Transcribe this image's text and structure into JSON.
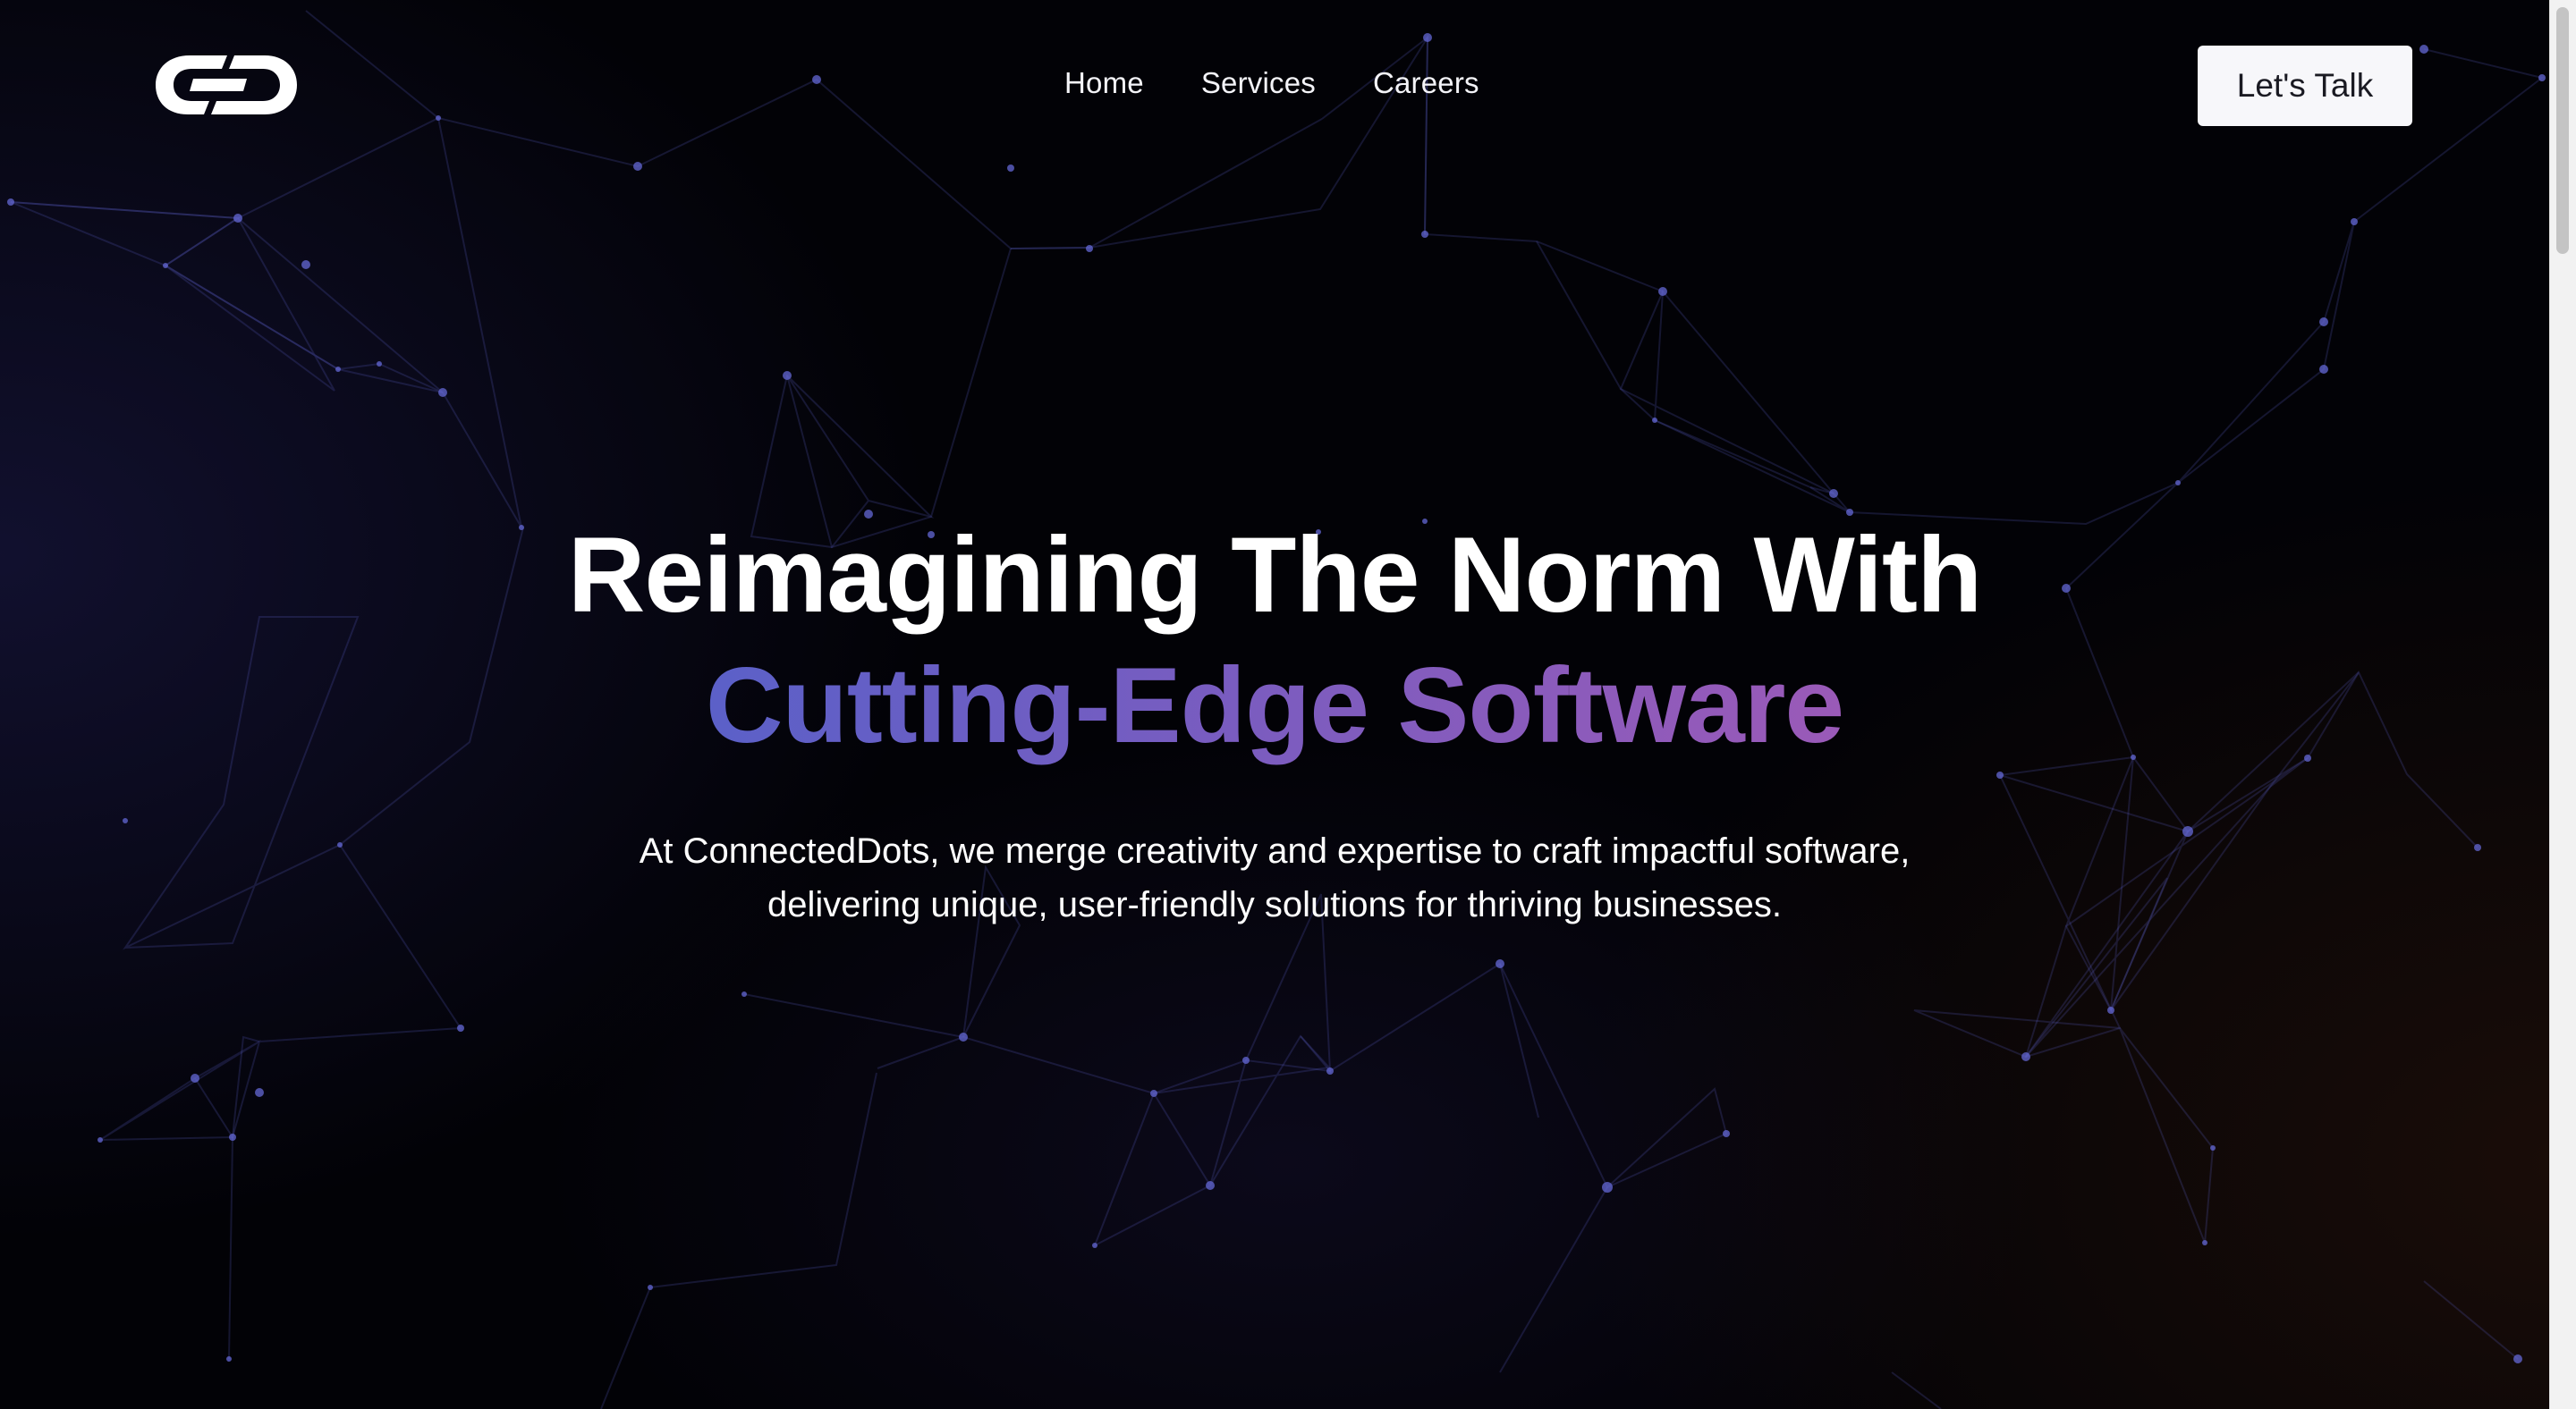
{
  "nav": {
    "logo_text": "CD",
    "links": [
      "Home",
      "Services",
      "Careers"
    ],
    "cta_label": "Let's Talk"
  },
  "hero": {
    "title_line1": "Reimagining The Norm With",
    "title_line2": "Cutting-Edge Software",
    "subtitle_line1": "At ConnectedDots, we merge creativity and expertise to craft impactful software,",
    "subtitle_line2": "delivering unique, user-friendly solutions for thriving businesses."
  },
  "colors": {
    "accent_gradient_start": "#5b60c8",
    "accent_gradient_end": "#9a5ab8",
    "network_line": "#4a4fa8",
    "cta_background": "#f7f7fa"
  }
}
